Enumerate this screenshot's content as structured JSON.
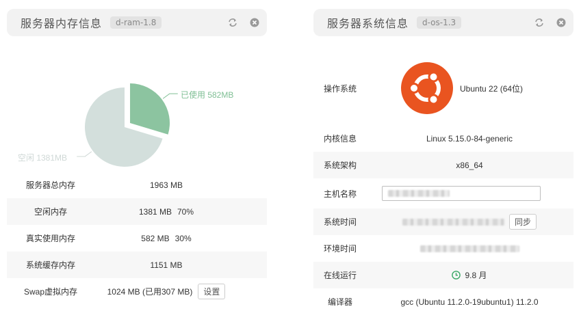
{
  "memory_panel": {
    "title": "服务器内存信息",
    "tag": "d-ram-1.8",
    "pie": {
      "used_label": "已使用 582MB",
      "free_label": "空闲 1381MB"
    },
    "rows": [
      {
        "label": "服务器总内存",
        "value": "1963 MB"
      },
      {
        "label": "空闲内存",
        "value": "1381 MB",
        "pct": "70%"
      },
      {
        "label": "真实使用内存",
        "value": "582 MB",
        "pct": "30%"
      },
      {
        "label": "系统缓存内存",
        "value": "1151 MB"
      },
      {
        "label": "Swap虚拟内存",
        "value": "1024 MB (已用307 MB)",
        "button": "设置"
      }
    ]
  },
  "system_panel": {
    "title": "服务器系统信息",
    "tag": "d-os-1.3",
    "rows": {
      "os": {
        "label": "操作系统",
        "value": "Ubuntu 22 (64位)"
      },
      "kernel": {
        "label": "内核信息",
        "value": "Linux 5.15.0-84-generic"
      },
      "arch": {
        "label": "系统架构",
        "value": "x86_64"
      },
      "hostname": {
        "label": "主机名称"
      },
      "sys_time": {
        "label": "系统时间",
        "button": "同步"
      },
      "env_time": {
        "label": "环境时间"
      },
      "uptime": {
        "label": "在线运行",
        "value": "9.8 月"
      },
      "compiler": {
        "label": "编译器",
        "value": "gcc (Ubuntu 11.2.0-19ubuntu1) 11.2.0"
      }
    }
  },
  "chart_data": {
    "type": "pie",
    "categories": [
      "已使用",
      "空闲"
    ],
    "values": [
      582,
      1381
    ],
    "unit": "MB",
    "colors": [
      "#8cc4a0",
      "#d3dfdc"
    ]
  },
  "colors": {
    "used": "#8cc4a0",
    "used_label": "#7fbf94",
    "free": "#d3dfdc",
    "free_label": "#cfd8d6",
    "ubuntu": "#e95420",
    "clock": "#3aa866"
  },
  "icons": {
    "refresh": "refresh-icon",
    "close": "close-circle-icon",
    "os_logo": "ubuntu-logo",
    "clock": "clock-icon"
  }
}
